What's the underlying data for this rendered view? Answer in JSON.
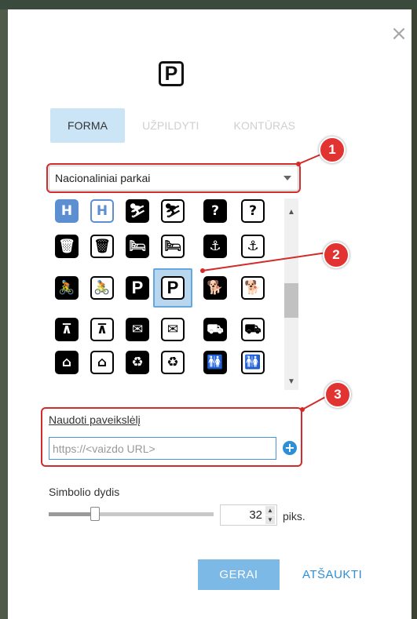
{
  "dialog": {
    "close_glyph": "×",
    "preview_symbol": "P",
    "tabs": [
      {
        "label": "FORMA",
        "active": true
      },
      {
        "label": "UŽPILDYTI",
        "active": false
      },
      {
        "label": "KONTŪRAS",
        "active": false
      }
    ],
    "category_select": {
      "value": "Nacionaliniai parkai"
    },
    "icon_grid": {
      "selected": {
        "row": 2,
        "col": 3,
        "symbol": "parking"
      },
      "rows": [
        [
          {
            "icon": "hospital-icon",
            "glyph": "H",
            "style": "solid-blue"
          },
          {
            "icon": "hospital-outline-icon",
            "glyph": "H",
            "style": "outline-blue"
          },
          {
            "icon": "skiing-icon",
            "glyph": "⛷",
            "style": "solid"
          },
          {
            "icon": "skiing-outline-icon",
            "glyph": "⛷",
            "style": "outline"
          },
          {
            "icon": "information-icon",
            "glyph": "?",
            "style": "solid"
          },
          {
            "icon": "information-outline-icon",
            "glyph": "?",
            "style": "outline"
          }
        ],
        [
          {
            "icon": "trash-can-icon",
            "glyph": "🗑",
            "style": "solid"
          },
          {
            "icon": "trash-can-outline-icon",
            "glyph": "🗑",
            "style": "outline"
          },
          {
            "icon": "lodging-icon",
            "glyph": "🛏",
            "style": "solid"
          },
          {
            "icon": "lodging-outline-icon",
            "glyph": "🛏",
            "style": "outline"
          },
          {
            "icon": "anchor-icon",
            "glyph": "⚓",
            "style": "solid"
          },
          {
            "icon": "anchor-outline-icon",
            "glyph": "⚓",
            "style": "outline"
          }
        ],
        [
          {
            "icon": "bicycle-trail-icon",
            "glyph": "🚴",
            "style": "solid"
          },
          {
            "icon": "bicycle-trail-outline-icon",
            "glyph": "🚴",
            "style": "outline"
          },
          {
            "icon": "parking-icon",
            "glyph": "P",
            "style": "solid"
          },
          {
            "icon": "parking-outline-icon",
            "glyph": "P",
            "style": "outline"
          },
          {
            "icon": "pets-icon",
            "glyph": "🐕",
            "style": "solid"
          },
          {
            "icon": "pets-outline-icon",
            "glyph": "🐕",
            "style": "outline"
          }
        ],
        [
          {
            "icon": "picnic-table-icon",
            "glyph": "⊼",
            "style": "solid"
          },
          {
            "icon": "picnic-table-outline-icon",
            "glyph": "⊼",
            "style": "outline"
          },
          {
            "icon": "post-office-icon",
            "glyph": "✉",
            "style": "solid"
          },
          {
            "icon": "post-office-outline-icon",
            "glyph": "✉",
            "style": "outline"
          },
          {
            "icon": "recycling-truck-icon",
            "glyph": "⛟",
            "style": "solid"
          },
          {
            "icon": "recycling-truck-outline-icon",
            "glyph": "⛟",
            "style": "outline"
          }
        ],
        [
          {
            "icon": "ranger-station-icon",
            "glyph": "⌂",
            "style": "solid"
          },
          {
            "icon": "ranger-station-outline-icon",
            "glyph": "⌂",
            "style": "outline"
          },
          {
            "icon": "recycling-icon",
            "glyph": "♻",
            "style": "solid"
          },
          {
            "icon": "recycling-outline-icon",
            "glyph": "♻",
            "style": "outline"
          },
          {
            "icon": "restrooms-icon",
            "glyph": "🚻",
            "style": "solid"
          },
          {
            "icon": "restrooms-outline-icon",
            "glyph": "🚻",
            "style": "outline"
          }
        ]
      ],
      "scroll_up_glyph": "▲",
      "scroll_down_glyph": "▼",
      "scroll_position": 0.45
    },
    "use_image": {
      "label": "Naudoti paveikslėlį",
      "url_value": "",
      "url_placeholder": "https://<vaizdo URL>",
      "add_glyph": "+"
    },
    "symbol_size": {
      "label": "Simbolio dydis",
      "value": "32",
      "unit": "piks.",
      "slider_fraction": 0.28,
      "spin_up_glyph": "▲",
      "spin_down_glyph": "▼"
    },
    "buttons": {
      "ok_label": "GERAI",
      "cancel_label": "ATŠAUKTI"
    }
  },
  "callouts": [
    "1",
    "2",
    "3"
  ],
  "colors": {
    "accent": "#2c8fd6",
    "active_tab_bg": "#cce5f6",
    "ok_button_bg": "#7cb9e7",
    "callout_red": "#e23333"
  }
}
